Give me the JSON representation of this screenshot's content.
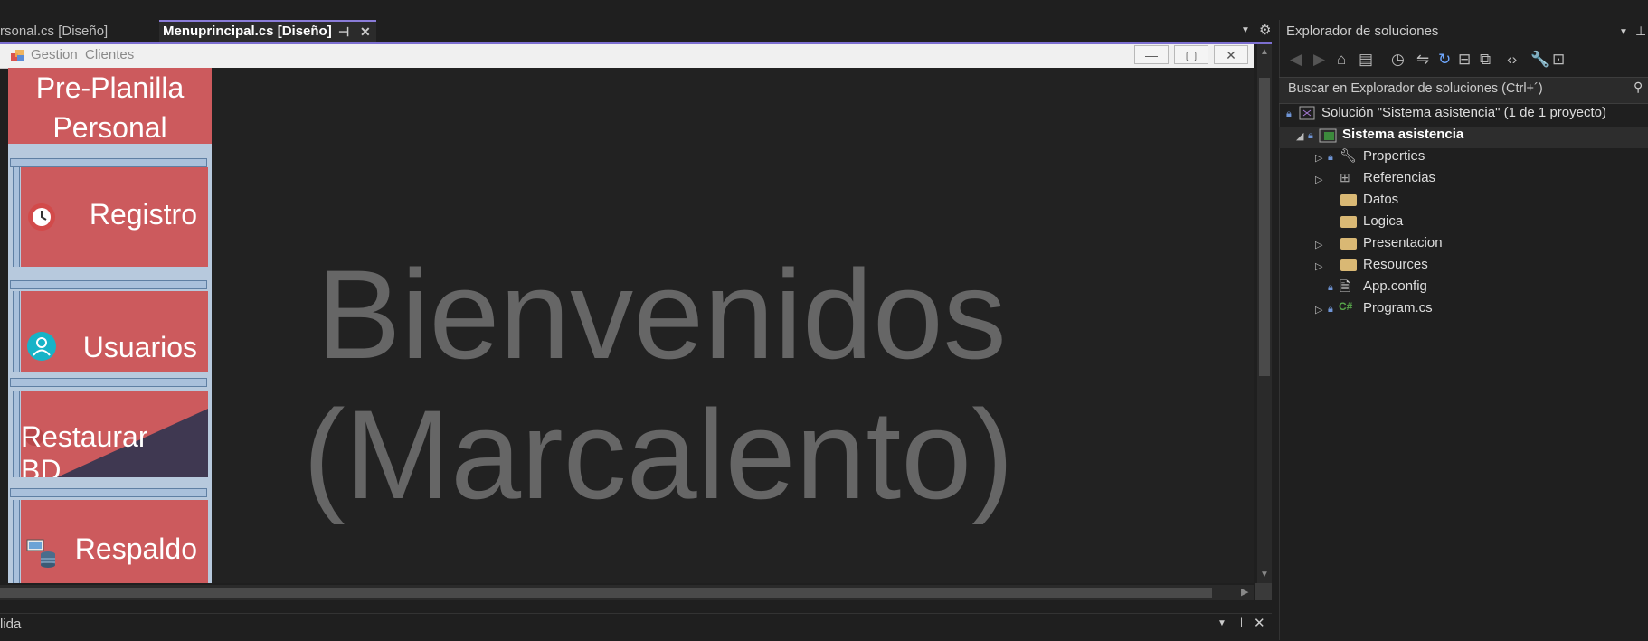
{
  "tabs": [
    {
      "label": "rsonal.cs [Diseño]",
      "active": false
    },
    {
      "label": "Menuprincipal.cs [Diseño]",
      "active": true
    }
  ],
  "tab_icons": {
    "pin": "⊣",
    "close": "✕"
  },
  "form": {
    "title": "Gestion_Clientes"
  },
  "sidebar": {
    "brand_line1": "Pre-Planilla",
    "brand_line2": "Personal",
    "items": [
      {
        "label": "Registro",
        "icon": "clock-icon"
      },
      {
        "label": "Usuarios",
        "icon": "user-icon"
      },
      {
        "label": "Restaurar BD",
        "icon": "restore-icon"
      },
      {
        "label": "Respaldo",
        "icon": "database-icon"
      }
    ]
  },
  "canvas": {
    "welcome_line1": "Bienvenidos",
    "welcome_line2": "(Marcalento)"
  },
  "output": {
    "title": "lida"
  },
  "explorer": {
    "title": "Explorador de soluciones",
    "search_placeholder": "Buscar en Explorador de soluciones (Ctrl+´)",
    "solution": "Solución \"Sistema asistencia\"  (1 de 1 proyecto)",
    "project": "Sistema asistencia",
    "items": [
      {
        "label": "Properties",
        "expandable": true
      },
      {
        "label": "Referencias",
        "expandable": true
      },
      {
        "label": "Datos",
        "expandable": false
      },
      {
        "label": "Logica",
        "expandable": false
      },
      {
        "label": "Presentacion",
        "expandable": true
      },
      {
        "label": "Resources",
        "expandable": true
      },
      {
        "label": "App.config",
        "expandable": false
      },
      {
        "label": "Program.cs",
        "expandable": true
      }
    ]
  },
  "colors": {
    "menu_red": "#cc5a5d",
    "sidebar_blue": "#b7c9dd",
    "accent": "#7c6fd0",
    "welcome_text": "#666666"
  }
}
